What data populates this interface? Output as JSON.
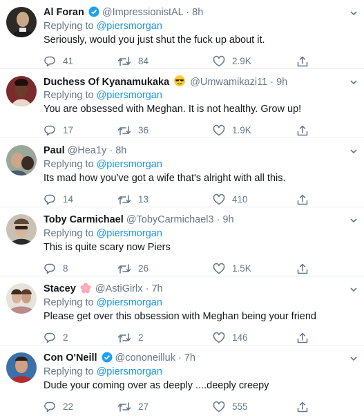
{
  "reply_prefix": "Replying to",
  "colors": {
    "link": "#1b95e0",
    "muted": "#657786",
    "verified": "#1da1f2",
    "divider": "#e6ecf0"
  },
  "tweets": [
    {
      "name": "Al Foran",
      "verified": true,
      "emoji": "",
      "handle": "@ImpressionistAL",
      "time": "8h",
      "reply_to": "@piersmorgan",
      "text": "Seriously, would you just shut the fuck up about it.",
      "replies": "41",
      "retweets": "84",
      "likes": "2.9K",
      "avatar_icon": "avatar-al-foran"
    },
    {
      "name": "Duchess Of Kyanamukaka",
      "verified": false,
      "emoji": "sunglasses-emoji",
      "handle": "@Umwamikazi11",
      "time": "9h",
      "reply_to": "@piersmorgan",
      "text": "You are obsessed with Meghan. It is not healthy. Grow up!",
      "replies": "17",
      "retweets": "36",
      "likes": "1.9K",
      "avatar_icon": "avatar-duchess"
    },
    {
      "name": "Paul",
      "verified": false,
      "emoji": "",
      "handle": "@Hea1y",
      "time": "8h",
      "reply_to": "@piersmorgan",
      "text": "Its mad how you've got a wife that's alright with all this.",
      "replies": "14",
      "retweets": "13",
      "likes": "410",
      "avatar_icon": "avatar-paul"
    },
    {
      "name": "Toby Carmichael",
      "verified": false,
      "emoji": "",
      "handle": "@TobyCarmichael3",
      "time": "9h",
      "reply_to": "@piersmorgan",
      "text": "This is quite scary now Piers",
      "replies": "8",
      "retweets": "26",
      "likes": "1.5K",
      "avatar_icon": "avatar-toby"
    },
    {
      "name": "Stacey",
      "verified": false,
      "emoji": "blossom-emoji",
      "handle": "@AstiGirlx",
      "time": "7h",
      "reply_to": "@piersmorgan",
      "text": "Please get over this obsession with Meghan being your friend",
      "replies": "2",
      "retweets": "2",
      "likes": "146",
      "avatar_icon": "avatar-stacey"
    },
    {
      "name": "Con O'Neill",
      "verified": true,
      "emoji": "",
      "handle": "@cononeilluk",
      "time": "7h",
      "reply_to": "@piersmorgan",
      "text": "Dude your coming over as deeply ....deeply creepy",
      "replies": "22",
      "retweets": "27",
      "likes": "555",
      "avatar_icon": "avatar-con-oneill"
    }
  ]
}
